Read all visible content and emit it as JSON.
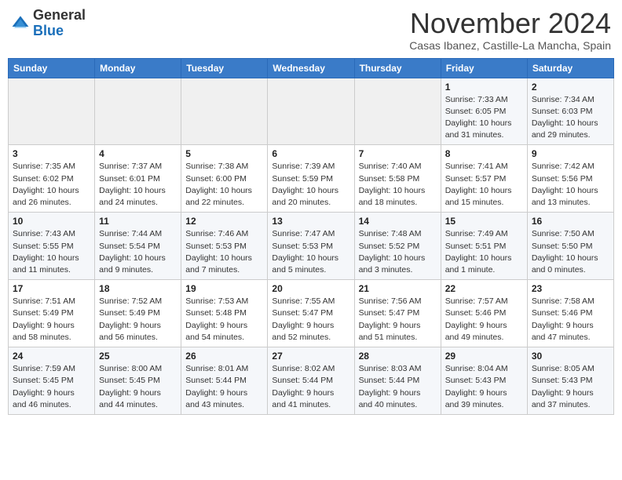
{
  "header": {
    "logo_line1": "General",
    "logo_line2": "Blue",
    "month": "November 2024",
    "location": "Casas Ibanez, Castille-La Mancha, Spain"
  },
  "weekdays": [
    "Sunday",
    "Monday",
    "Tuesday",
    "Wednesday",
    "Thursday",
    "Friday",
    "Saturday"
  ],
  "weeks": [
    [
      {
        "day": "",
        "info": ""
      },
      {
        "day": "",
        "info": ""
      },
      {
        "day": "",
        "info": ""
      },
      {
        "day": "",
        "info": ""
      },
      {
        "day": "",
        "info": ""
      },
      {
        "day": "1",
        "info": "Sunrise: 7:33 AM\nSunset: 6:05 PM\nDaylight: 10 hours\nand 31 minutes."
      },
      {
        "day": "2",
        "info": "Sunrise: 7:34 AM\nSunset: 6:03 PM\nDaylight: 10 hours\nand 29 minutes."
      }
    ],
    [
      {
        "day": "3",
        "info": "Sunrise: 7:35 AM\nSunset: 6:02 PM\nDaylight: 10 hours\nand 26 minutes."
      },
      {
        "day": "4",
        "info": "Sunrise: 7:37 AM\nSunset: 6:01 PM\nDaylight: 10 hours\nand 24 minutes."
      },
      {
        "day": "5",
        "info": "Sunrise: 7:38 AM\nSunset: 6:00 PM\nDaylight: 10 hours\nand 22 minutes."
      },
      {
        "day": "6",
        "info": "Sunrise: 7:39 AM\nSunset: 5:59 PM\nDaylight: 10 hours\nand 20 minutes."
      },
      {
        "day": "7",
        "info": "Sunrise: 7:40 AM\nSunset: 5:58 PM\nDaylight: 10 hours\nand 18 minutes."
      },
      {
        "day": "8",
        "info": "Sunrise: 7:41 AM\nSunset: 5:57 PM\nDaylight: 10 hours\nand 15 minutes."
      },
      {
        "day": "9",
        "info": "Sunrise: 7:42 AM\nSunset: 5:56 PM\nDaylight: 10 hours\nand 13 minutes."
      }
    ],
    [
      {
        "day": "10",
        "info": "Sunrise: 7:43 AM\nSunset: 5:55 PM\nDaylight: 10 hours\nand 11 minutes."
      },
      {
        "day": "11",
        "info": "Sunrise: 7:44 AM\nSunset: 5:54 PM\nDaylight: 10 hours\nand 9 minutes."
      },
      {
        "day": "12",
        "info": "Sunrise: 7:46 AM\nSunset: 5:53 PM\nDaylight: 10 hours\nand 7 minutes."
      },
      {
        "day": "13",
        "info": "Sunrise: 7:47 AM\nSunset: 5:53 PM\nDaylight: 10 hours\nand 5 minutes."
      },
      {
        "day": "14",
        "info": "Sunrise: 7:48 AM\nSunset: 5:52 PM\nDaylight: 10 hours\nand 3 minutes."
      },
      {
        "day": "15",
        "info": "Sunrise: 7:49 AM\nSunset: 5:51 PM\nDaylight: 10 hours\nand 1 minute."
      },
      {
        "day": "16",
        "info": "Sunrise: 7:50 AM\nSunset: 5:50 PM\nDaylight: 10 hours\nand 0 minutes."
      }
    ],
    [
      {
        "day": "17",
        "info": "Sunrise: 7:51 AM\nSunset: 5:49 PM\nDaylight: 9 hours\nand 58 minutes."
      },
      {
        "day": "18",
        "info": "Sunrise: 7:52 AM\nSunset: 5:49 PM\nDaylight: 9 hours\nand 56 minutes."
      },
      {
        "day": "19",
        "info": "Sunrise: 7:53 AM\nSunset: 5:48 PM\nDaylight: 9 hours\nand 54 minutes."
      },
      {
        "day": "20",
        "info": "Sunrise: 7:55 AM\nSunset: 5:47 PM\nDaylight: 9 hours\nand 52 minutes."
      },
      {
        "day": "21",
        "info": "Sunrise: 7:56 AM\nSunset: 5:47 PM\nDaylight: 9 hours\nand 51 minutes."
      },
      {
        "day": "22",
        "info": "Sunrise: 7:57 AM\nSunset: 5:46 PM\nDaylight: 9 hours\nand 49 minutes."
      },
      {
        "day": "23",
        "info": "Sunrise: 7:58 AM\nSunset: 5:46 PM\nDaylight: 9 hours\nand 47 minutes."
      }
    ],
    [
      {
        "day": "24",
        "info": "Sunrise: 7:59 AM\nSunset: 5:45 PM\nDaylight: 9 hours\nand 46 minutes."
      },
      {
        "day": "25",
        "info": "Sunrise: 8:00 AM\nSunset: 5:45 PM\nDaylight: 9 hours\nand 44 minutes."
      },
      {
        "day": "26",
        "info": "Sunrise: 8:01 AM\nSunset: 5:44 PM\nDaylight: 9 hours\nand 43 minutes."
      },
      {
        "day": "27",
        "info": "Sunrise: 8:02 AM\nSunset: 5:44 PM\nDaylight: 9 hours\nand 41 minutes."
      },
      {
        "day": "28",
        "info": "Sunrise: 8:03 AM\nSunset: 5:44 PM\nDaylight: 9 hours\nand 40 minutes."
      },
      {
        "day": "29",
        "info": "Sunrise: 8:04 AM\nSunset: 5:43 PM\nDaylight: 9 hours\nand 39 minutes."
      },
      {
        "day": "30",
        "info": "Sunrise: 8:05 AM\nSunset: 5:43 PM\nDaylight: 9 hours\nand 37 minutes."
      }
    ]
  ]
}
